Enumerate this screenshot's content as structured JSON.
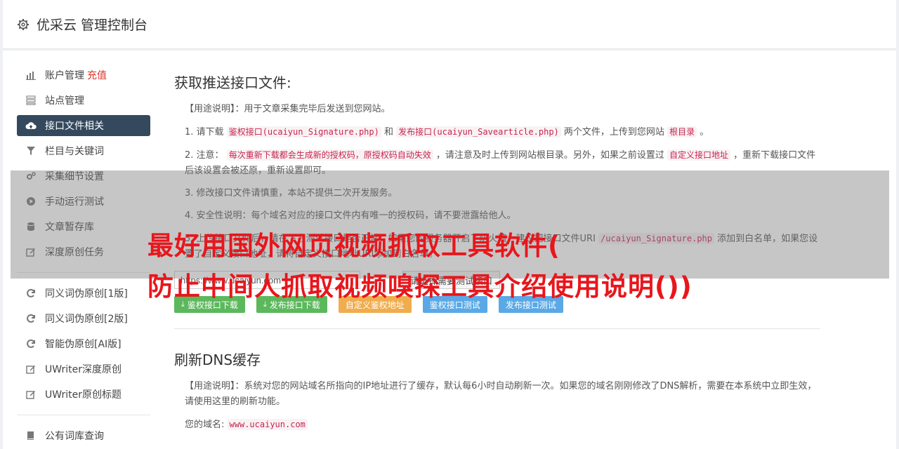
{
  "header": {
    "title": "优采云 管理控制台",
    "icon": "gear-icon"
  },
  "sidebar": {
    "items": [
      {
        "label": "账户管理",
        "extra": "充值",
        "icon": "bar-chart-icon"
      },
      {
        "label": "站点管理",
        "icon": "server-icon"
      },
      {
        "label": "接口文件相关",
        "icon": "cloud-upload-icon",
        "active": true
      },
      {
        "label": "栏目与关键词",
        "icon": "filter-icon"
      },
      {
        "label": "采集细节设置",
        "icon": "gears-icon"
      },
      {
        "label": "手动运行测试",
        "icon": "play-circle-icon"
      },
      {
        "label": "文章暂存库",
        "icon": "database-icon"
      },
      {
        "label": "深度原创任务",
        "icon": "edit-icon"
      },
      {
        "label": "同义词伪原创[1版]",
        "icon": "refresh-icon"
      },
      {
        "label": "同义词伪原创[2版]",
        "icon": "refresh-icon"
      },
      {
        "label": "智能伪原创[AI版]",
        "icon": "refresh-icon"
      },
      {
        "label": "UWriter深度原创",
        "icon": "edit-icon"
      },
      {
        "label": "UWriter原创标题",
        "icon": "edit-icon"
      },
      {
        "label": "公有词库查询",
        "icon": "book-icon"
      }
    ]
  },
  "section1": {
    "title": "获取推送接口文件:",
    "usage": "【用途说明】：用于文章采集完毕后发送到您网站。",
    "step1": {
      "prefix": "1. 请下载",
      "code1": "鉴权接口(ucaiyun_Signature.php)",
      "and": "和",
      "code2": "发布接口(ucaiyun_Savearticle.php)",
      "mid": "两个文件，上传到您网站",
      "code3": "根目录",
      "suffix": "。"
    },
    "step2": {
      "prefix": "2. 注意：",
      "code1": "每次重新下载都会生成新的授权码，原授权码自动失效",
      "mid": "，请注意及时上传到网站根目录。另外，如果之前设置过",
      "code2": "自定义接口地址",
      "suffix": "，重新下载接口文件后该设置会被还原，重新设置即可。"
    },
    "step3": "3. 修改接口文件请慎重，本站不提供二次开发服务。",
    "step4": "4. 安全性说明：每个域名对应的接口文件内有唯一的授权码，请不要泄露给他人。",
    "step5": {
      "prefix": "5. 上传接口文件后，请在下方测试接口是否正常，如果您的服务器开启了防火墙，建议把接口文件URI",
      "code": "/ucaiyun_Signature.php",
      "suffix": "添加到白名单，如果您设置了自定义接口地址，请将自定义接口地址URI添加到白名单。"
    },
    "url_value": "https://www.ucaiyun.com",
    "url_button": "请选择需要测试接口",
    "buttons": [
      "鉴权接口下载",
      "发布接口下载",
      "自定义鉴权地址",
      "鉴权接口测试",
      "发布接口测试"
    ]
  },
  "section2": {
    "title": "刷新DNS缓存",
    "usage": "【用途说明】：系统对您的网站域名所指向的IP地址进行了缓存，默认每6小时自动刷新一次。如果您的域名刚刚修改了DNS解析，需要在本系统中立即生效，请使用这里的刷新功能。",
    "domain_label": "您的域名:",
    "domain_value": "www.ucaiyun.com"
  },
  "overlay": {
    "line1": "最好用国外网页视频抓取工具软件(",
    "line2": "防止中间人抓取视频嗅探工具介绍使用说明())"
  }
}
